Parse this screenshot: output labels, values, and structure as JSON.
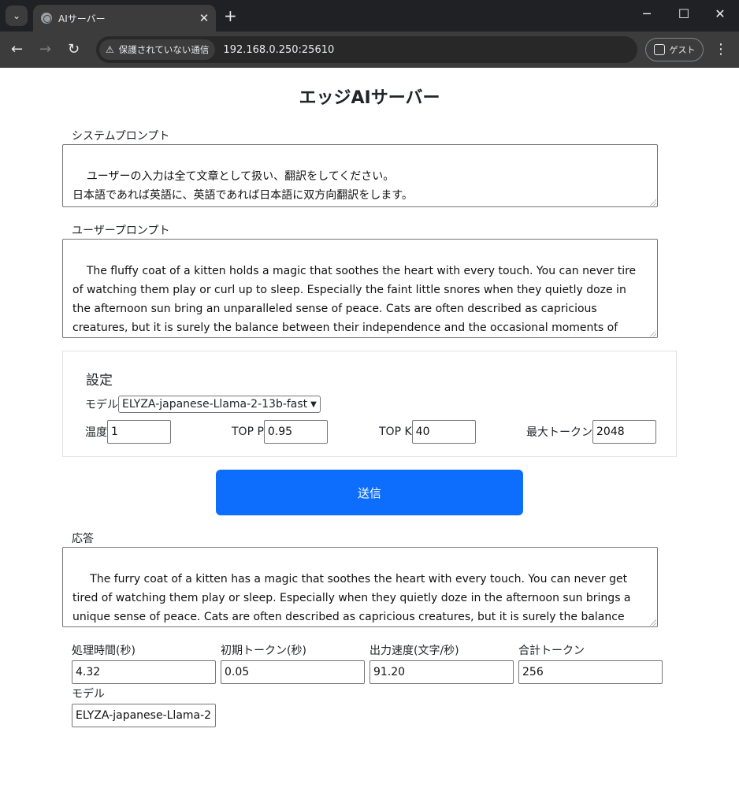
{
  "browser": {
    "tab_title": "AIサーバー",
    "tab_close": "✕",
    "new_tab": "+",
    "security_label": "保護されていない通信",
    "url": "192.168.0.250:25610",
    "guest_label": "ゲスト",
    "window_controls": [
      "─",
      "☐",
      "✕"
    ]
  },
  "page": {
    "title": "エッジAIサーバー",
    "system_prompt_label": "システムプロンプト",
    "system_prompt": "ユーザーの入力は全て文章として扱い、翻訳をしてください。\n日本語であれば英語に、英語であれば日本語に双方向翻訳をします。\n余計な出力はせず、訳文だけを出力してください。",
    "user_prompt_label": "ユーザープロンプト",
    "user_prompt": "The fluffy coat of a kitten holds a magic that soothes the heart with every touch. You can never tire of watching them play or curl up to sleep. Especially the faint little snores when they quietly doze in the afternoon sun bring an unparalleled sense of peace. Cats are often described as capricious creatures, but it is surely the balance between their independence and the occasional moments of seeking affection that makes up their irresistible charm.",
    "settings": {
      "title": "設定",
      "model_label": "モデル",
      "model_value": "ELYZA-japanese-Llama-2-13b-fast",
      "temperature_label": "温度",
      "temperature_value": "1",
      "top_p_label": "TOP P",
      "top_p_value": "0.95",
      "top_k_label": "TOP K",
      "top_k_value": "40",
      "max_tokens_label": "最大トークン",
      "max_tokens_value": "2048"
    },
    "send_label": "送信",
    "response_label": "応答",
    "response": " The furry coat of a kitten has a magic that soothes the heart with every touch. You can never get tired of watching them play or sleep. Especially when they quietly doze in the afternoon sun brings a unique sense of peace. Cats are often described as capricious creatures, but it is surely the balance between their independence and occasional affection that makes up their irresistible charm。",
    "stats": {
      "processing_time_label": "処理時間(秒)",
      "processing_time_value": "4.32",
      "initial_token_label": "初期トークン(秒)",
      "initial_token_value": "0.05",
      "output_speed_label": "出力速度(文字/秒)",
      "output_speed_value": "91.20",
      "total_tokens_label": "合計トークン",
      "total_tokens_value": "256",
      "model_label": "モデル",
      "model_value": "ELYZA-japanese-Llama-2"
    }
  }
}
